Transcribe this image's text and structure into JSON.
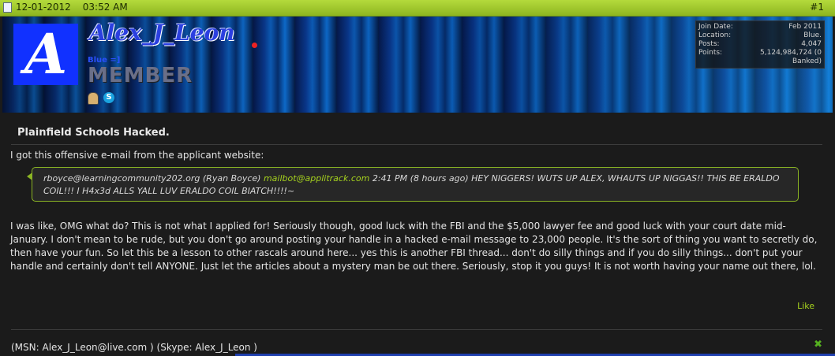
{
  "header": {
    "date": "12-01-2012",
    "time": "03:52 AM",
    "post_number": "#1"
  },
  "profile": {
    "avatar_letter": "A",
    "username": "Alex_J_Leon",
    "custom_text": "Blue =]",
    "rank": "MEMBER",
    "stats": [
      {
        "label": "Join Date:",
        "value": "Feb 2011"
      },
      {
        "label": "Location:",
        "value": "Blue."
      },
      {
        "label": "Posts:",
        "value": "4,047"
      },
      {
        "label": "Points:",
        "value": "5,124,984,724 (0 Banked)"
      }
    ]
  },
  "post": {
    "title": "Plainfield Schools Hacked.",
    "intro": "I got this offensive e-mail from the applicant website:",
    "quote": {
      "sender": "rboyce@learningcommunity202.org (Ryan Boyce)",
      "link": "mailbot@applitrack.com",
      "message": "2:41 PM (8 hours ago) HEY NIGGERS! WUTS UP ALEX, WHAUTS UP NIGGAS!! THIS BE ERALDO COIL!!! I H4x3d ALLS YALL LUV ERALDO COIL BIATCH!!!!~"
    },
    "body": "I was like, OMG what do? This is not what I applied for! Seriously though, good luck with the FBI and the $5,000 lawyer fee and good luck with your court date mid-January. I don't mean to be rude, but you don't go around posting your handle in a hacked e-mail message to 23,000 people. It's the sort of thing you want to secretly do, then have your fun. So let this be a lesson to other rascals around here... yes this is another FBI thread... don't do silly things and if you do silly things... don't put your handle and certainly don't tell ANYONE. Just let the articles about a mystery man be out there. Seriously, stop it you guys! It is not worth having your name out there, lol.",
    "like_label": "Like",
    "signature": "(MSN: Alex_J_Leon@live.com ) (Skype: Alex_J_Leon )"
  }
}
